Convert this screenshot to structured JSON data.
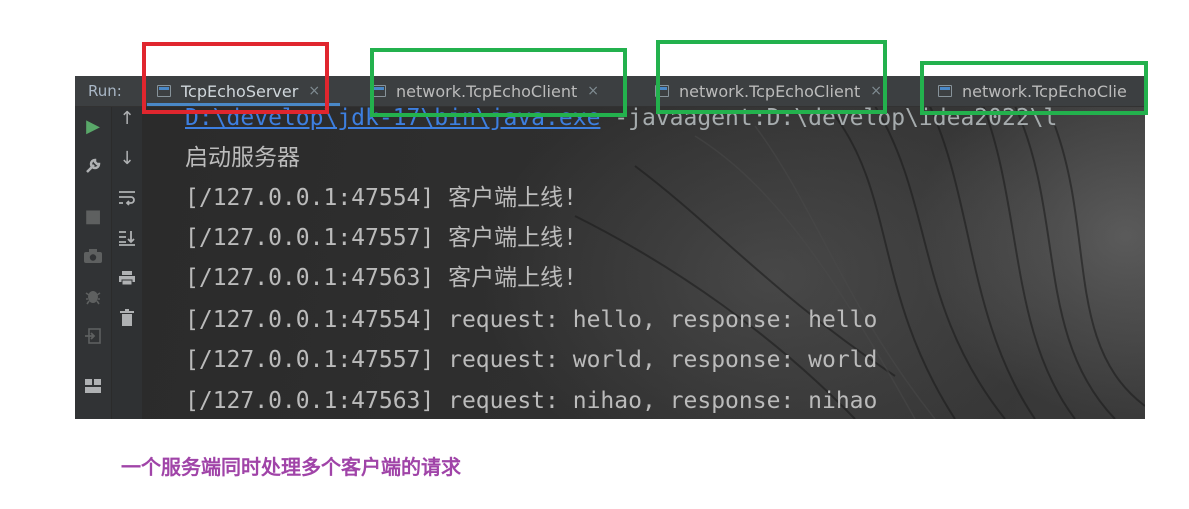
{
  "run_panel": {
    "run_label": "Run:",
    "tabs": [
      {
        "label": "TcpEchoServer",
        "close": "×",
        "active": true
      },
      {
        "label": "network.TcpEchoClient",
        "close": "×",
        "active": false
      },
      {
        "label": "network.TcpEchoClient",
        "close": "×",
        "active": false
      },
      {
        "label": "network.TcpEchoClie",
        "close": "",
        "active": false
      }
    ],
    "left_toolbar": [
      "run-icon",
      "wrench-icon",
      "stop-icon",
      "camera-icon",
      "debug-icon",
      "exit-icon",
      "layout-icon"
    ],
    "second_toolbar": [
      "up-arrow-icon",
      "down-arrow-icon",
      "soft-wrap-icon",
      "scroll-to-end-icon",
      "print-icon",
      "trash-icon"
    ],
    "console": {
      "command_link": "D:\\develop\\jdk-17\\bin\\java.exe",
      "command_rest": " -javaagent:D:\\develop\\idea2022\\l",
      "lines": [
        "启动服务器",
        "[/127.0.0.1:47554] 客户端上线!",
        "[/127.0.0.1:47557] 客户端上线!",
        "[/127.0.0.1:47563] 客户端上线!",
        "[/127.0.0.1:47554] request: hello, response: hello",
        "[/127.0.0.1:47557] request: world, response: world",
        "[/127.0.0.1:47563] request: nihao, response: nihao"
      ]
    }
  },
  "caption": "一个服务端同时处理多个客户端的请求",
  "colors": {
    "server_box": "#e0262e",
    "client_box": "#23b14d",
    "caption": "#a044a8"
  }
}
